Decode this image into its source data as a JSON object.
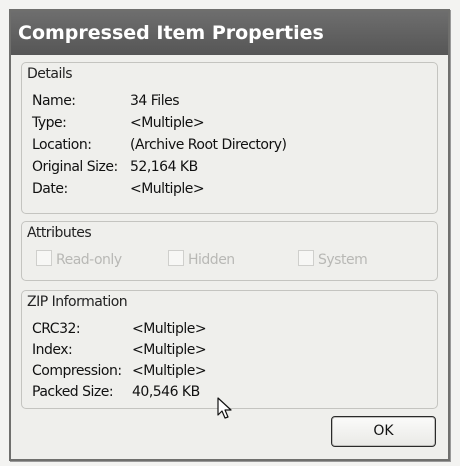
{
  "window": {
    "title": "Compressed Item Properties"
  },
  "details": {
    "heading": "Details",
    "rows": [
      {
        "label": "Name:",
        "value": "34 Files"
      },
      {
        "label": "Type:",
        "value": "<Multiple>"
      },
      {
        "label": "Location:",
        "value": "(Archive Root Directory)"
      },
      {
        "label": "Original Size:",
        "value": "52,164 KB"
      },
      {
        "label": "Date:",
        "value": "<Multiple>"
      }
    ]
  },
  "attributes": {
    "heading": "Attributes",
    "items": [
      {
        "label": "Read-only",
        "checked": false,
        "enabled": false
      },
      {
        "label": "Hidden",
        "checked": false,
        "enabled": false
      },
      {
        "label": "System",
        "checked": false,
        "enabled": false
      }
    ]
  },
  "zip": {
    "heading": "ZIP Information",
    "rows": [
      {
        "label": "CRC32:",
        "value": "<Multiple>"
      },
      {
        "label": "Index:",
        "value": "<Multiple>"
      },
      {
        "label": "Compression:",
        "value": "<Multiple>"
      },
      {
        "label": "Packed Size:",
        "value": "40,546 KB"
      }
    ]
  },
  "buttons": {
    "ok": "OK"
  },
  "icons": {
    "cursor": "arrow-cursor-icon"
  }
}
